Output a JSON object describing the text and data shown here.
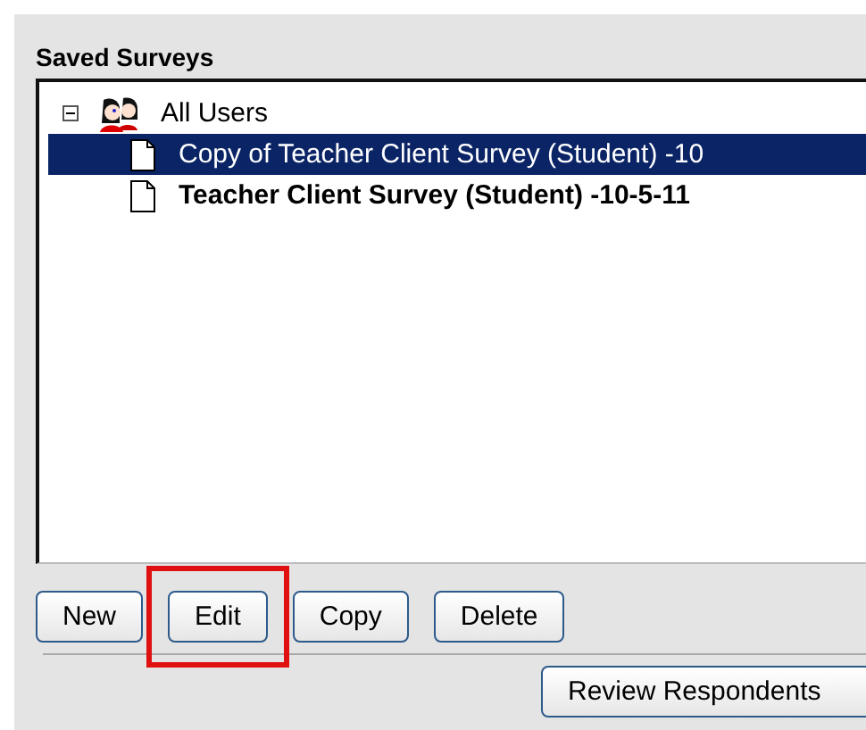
{
  "panel": {
    "title": "Saved Surveys"
  },
  "tree": [
    {
      "label": "All Users",
      "kind": "group",
      "expanded": true,
      "selected": false,
      "bold": false,
      "children": [
        {
          "label": "Copy of Teacher Client Survey (Student) -10",
          "kind": "survey",
          "selected": true,
          "bold": false
        },
        {
          "label": "Teacher Client Survey (Student) -10-5-11",
          "kind": "survey",
          "selected": false,
          "bold": true
        }
      ]
    }
  ],
  "buttons": [
    {
      "label": "New",
      "highlighted": false
    },
    {
      "label": "Edit",
      "highlighted": true
    },
    {
      "label": "Copy",
      "highlighted": false
    },
    {
      "label": "Delete",
      "highlighted": false
    }
  ],
  "footer_buttons": [
    {
      "label": "Review Respondents"
    }
  ]
}
